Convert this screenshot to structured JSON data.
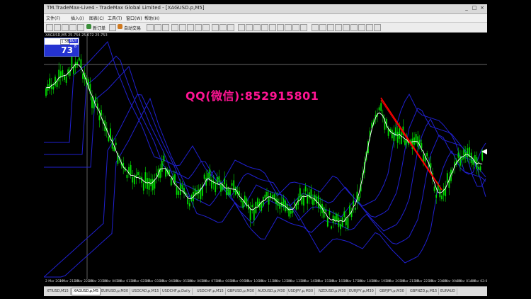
{
  "window": {
    "title": "TM.TradeMax-Live4 - TradeMax Global Limited - [XAGUSD.p,M5]",
    "controls": [
      "_",
      "□",
      "×"
    ]
  },
  "menu": {
    "items": [
      "文件(F)",
      "插入(I)",
      "图表(C)",
      "工具(T)",
      "窗口(W)",
      "帮助(H)"
    ]
  },
  "toolbar": {
    "new_order_label": "新订单",
    "auto_trading_label": "自动交易"
  },
  "chart": {
    "info_line": "XAGUSD,M5 25.754 25.672 25.753",
    "one_click": {
      "lot": "1.58",
      "buy_label": "BUY",
      "price_big": "73",
      "price_sup": "8"
    },
    "watermark": "QQ(微信):852915801",
    "time_labels": [
      "2 Mar 2016",
      "2 Mar 21:00",
      "2 Mar 22:00",
      "2 Mar 23:00",
      "3 Mar 00:00",
      "3 Mar 01:00",
      "3 Mar 02:00",
      "3 Mar 03:00",
      "3 Mar 04:00",
      "3 Mar 05:00",
      "3 Mar 06:00",
      "3 Mar 07:00",
      "3 Mar 08:00",
      "3 Mar 09:00",
      "3 Mar 10:00",
      "3 Mar 11:00",
      "3 Mar 12:00",
      "3 Mar 13:00",
      "3 Mar 14:00",
      "3 Mar 15:00",
      "3 Mar 16:00",
      "3 Mar 17:00",
      "3 Mar 18:00",
      "3 Mar 19:00",
      "3 Mar 20:00",
      "3 Mar 21:00",
      "3 Mar 22:00",
      "3 Mar 23:00",
      "4 Mar 00:00",
      "4 Mar 01:00",
      "4 Mar 02:00"
    ],
    "colors": {
      "candle": "#00e000",
      "price_line": "#ffffff",
      "bands": "#2020d0",
      "trend": "#ff0000",
      "watermark": "#ff1493"
    }
  },
  "tabs": {
    "items": [
      "XTIUSD,M15",
      "XAGUSD,p,M5",
      "EURUSD,p,M30",
      "USDCAD,p,M15",
      "USDCHF,p,Daily",
      "USDCHF,p,M15",
      "GBPUSD,p,M30",
      "AUDUSD,p,M30",
      "USDJPY,p,M30",
      "NZDUSD,p,M30",
      "EURJPY,p,M30",
      "GBPJPY,p,M30",
      "GBPNZD,p,M15",
      "EURAUD"
    ],
    "active_index": 1
  }
}
